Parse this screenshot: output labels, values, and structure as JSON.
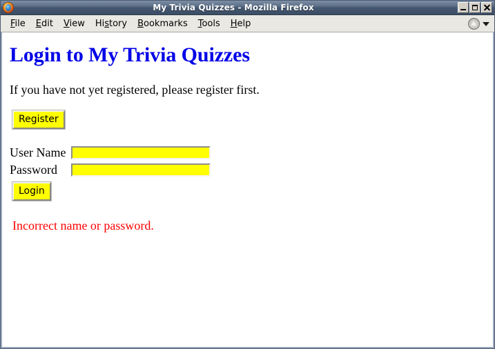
{
  "window": {
    "title": "My Trivia Quizzes - Mozilla Firefox",
    "app_icon": "firefox-icon",
    "controls": {
      "minimize": "minimize-icon",
      "maximize": "maximize-icon",
      "close": "close-icon"
    }
  },
  "menubar": {
    "items": [
      {
        "label": "File",
        "accel": "F"
      },
      {
        "label": "Edit",
        "accel": "E"
      },
      {
        "label": "View",
        "accel": "V"
      },
      {
        "label": "History",
        "accel": "s"
      },
      {
        "label": "Bookmarks",
        "accel": "B"
      },
      {
        "label": "Tools",
        "accel": "T"
      },
      {
        "label": "Help",
        "accel": "H"
      }
    ],
    "right_icons": [
      "circle-triangle-icon",
      "chevron-down-icon"
    ]
  },
  "page": {
    "heading": "Login to My Trivia Quizzes",
    "intro": "If you have not yet registered, please register first.",
    "register_button": "Register",
    "login_button": "Login",
    "form": {
      "username_label": "User Name",
      "username_value": "",
      "password_label": "Password",
      "password_value": ""
    },
    "error_message": "Incorrect name or password."
  },
  "colors": {
    "heading": "#0000e8",
    "error": "#ff0000",
    "field_fill": "#ffff00",
    "button_fill": "#ffff00",
    "titlebar": "#44576f",
    "menubar": "#e9e8e3"
  }
}
